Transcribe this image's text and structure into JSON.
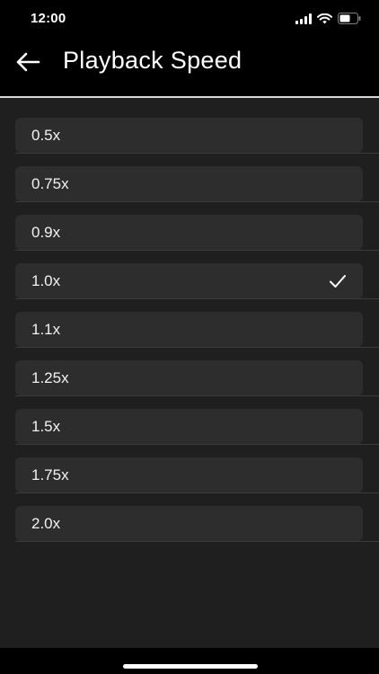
{
  "status": {
    "time": "12:00",
    "icons": [
      "signal-icon",
      "wifi-icon",
      "battery-icon"
    ]
  },
  "header": {
    "back_icon": "arrow-left-icon",
    "title": "Playback Speed"
  },
  "speeds": {
    "selected": "1.0x",
    "items": [
      {
        "label": "0.5x"
      },
      {
        "label": "0.75x"
      },
      {
        "label": "0.9x"
      },
      {
        "label": "1.0x"
      },
      {
        "label": "1.1x"
      },
      {
        "label": "1.25x"
      },
      {
        "label": "1.5x"
      },
      {
        "label": "1.75x"
      },
      {
        "label": "2.0x"
      }
    ]
  },
  "colors": {
    "background": "#1f1f1f",
    "row": "#2d2d2d",
    "bar": "#000000",
    "text": "#ffffff"
  }
}
